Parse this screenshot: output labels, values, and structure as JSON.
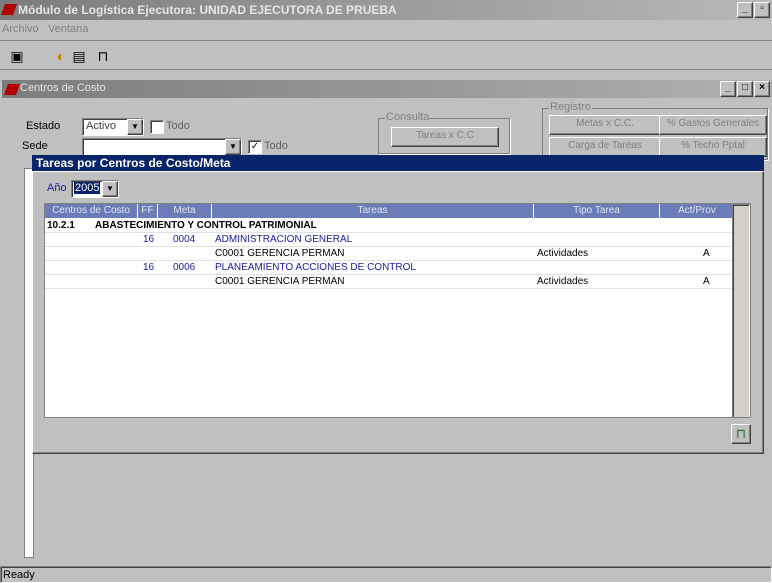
{
  "app": {
    "title": "Módulo de Logística   Ejecutora: UNIDAD EJECUTORA DE PRUEBA",
    "menu": [
      "Archivo",
      "Ventana"
    ],
    "window_buttons": [
      "_",
      "▫"
    ]
  },
  "toolbar": {
    "buttons": [
      {
        "icon": "save-icon",
        "glyph": "▣"
      },
      {
        "icon": "refresh-icon",
        "glyph": "◐"
      },
      {
        "icon": "print-icon",
        "glyph": "▤"
      },
      {
        "icon": "exit-icon",
        "glyph": "⊓"
      }
    ]
  },
  "centros": {
    "title": "Centros de Costo",
    "window_buttons": [
      "_",
      "□",
      "×"
    ],
    "estado_label": "Estado",
    "estado_value": "Activo",
    "todo_label": "Todo",
    "sede_label": "Sede",
    "sede_value": "",
    "todo2_label": "Todo",
    "consulta": {
      "group_label": "Consulta",
      "tareas_button": "Tareas x C.C"
    },
    "registro": {
      "group_label": "Registro",
      "buttons": [
        "Metas x C.C.",
        "% Gastos Generales",
        "Carga de Tareas",
        "% Techo Pptal"
      ]
    }
  },
  "dialog": {
    "title": "Tareas por Centros de Costo/Meta",
    "ano_label": "Año",
    "ano_value": "2005",
    "columns": [
      "Centros de Costo",
      "FF",
      "Meta",
      "Tareas",
      "Tipo Tarea",
      "Act/Prov"
    ],
    "rows": [
      {
        "cc": "10.2.1",
        "ff": "",
        "meta": "",
        "tarea": "ABASTECIMIENTO Y CONTROL PATRIMONIAL",
        "tipo": "",
        "act": "",
        "kind": "group"
      },
      {
        "cc": "",
        "ff": "16",
        "meta": "0004",
        "tarea": "ADMINISTRACION GENERAL",
        "tipo": "",
        "act": "",
        "kind": "meta"
      },
      {
        "cc": "",
        "ff": "",
        "meta": "",
        "tarea": "C0001   GERENCIA PERMAN",
        "tipo": "Actividades",
        "act": "A",
        "kind": "task"
      },
      {
        "cc": "",
        "ff": "16",
        "meta": "0006",
        "tarea": "PLANEAMIENTO ACCIONES DE CONTROL",
        "tipo": "",
        "act": "",
        "kind": "meta"
      },
      {
        "cc": "",
        "ff": "",
        "meta": "",
        "tarea": "C0001   GERENCIA PERMAN",
        "tipo": "Actividades",
        "act": "A",
        "kind": "task"
      }
    ],
    "exit_icon": "exit-icon"
  },
  "status": {
    "text": "Ready"
  }
}
